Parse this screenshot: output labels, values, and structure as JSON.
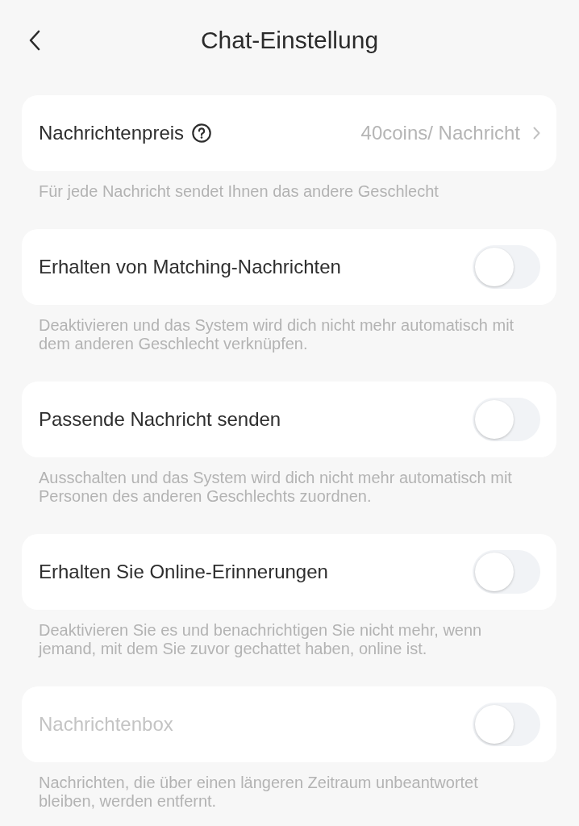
{
  "header": {
    "title": "Chat-Einstellung"
  },
  "settings": [
    {
      "kind": "link",
      "label": "Nachrichtenpreis",
      "help": true,
      "disabled": false,
      "value": "40coins/ Nachricht",
      "description": "Für jede Nachricht sendet Ihnen das andere Geschlecht"
    },
    {
      "kind": "switch",
      "label": "Erhalten von Matching-Nachrichten",
      "help": false,
      "disabled": false,
      "on": false,
      "description": "Deaktivieren und das System wird dich nicht mehr automatisch mit dem anderen Geschlecht verknüpfen."
    },
    {
      "kind": "switch",
      "label": "Passende Nachricht senden",
      "help": false,
      "disabled": false,
      "on": false,
      "description": "Ausschalten und das System wird dich nicht mehr automatisch mit Personen des anderen Geschlechts zuordnen."
    },
    {
      "kind": "switch",
      "label": "Erhalten Sie Online-Erinnerungen",
      "help": false,
      "disabled": false,
      "on": false,
      "description": "Deaktivieren Sie es und benachrichtigen Sie nicht mehr, wenn jemand, mit dem Sie zuvor gechattet haben, online ist."
    },
    {
      "kind": "switch",
      "label": "Nachrichtenbox",
      "help": false,
      "disabled": true,
      "on": false,
      "description": "Nachrichten, die über einen längeren Zeitraum unbeantwortet bleiben, werden entfernt."
    }
  ]
}
